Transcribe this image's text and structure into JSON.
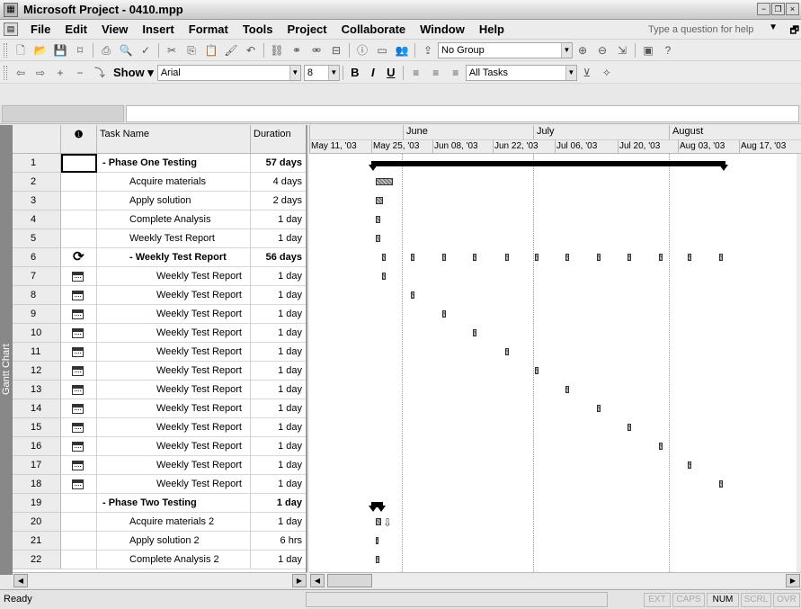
{
  "window": {
    "title": "Microsoft Project - 0410.mpp",
    "controls": [
      "−",
      "❐",
      "×"
    ]
  },
  "menu": {
    "items": [
      "File",
      "Edit",
      "View",
      "Insert",
      "Format",
      "Tools",
      "Project",
      "Collaborate",
      "Window",
      "Help"
    ],
    "help_placeholder": "Type a question for help"
  },
  "toolbar_standard": {
    "group_combo": "No Group"
  },
  "toolbar_formatting": {
    "show_label": "Show",
    "font": "Arial",
    "font_size": "8",
    "bold": "B",
    "italic": "I",
    "underline": "U",
    "filter_combo": "All Tasks"
  },
  "view_bar": {
    "label": "Gantt Chart"
  },
  "table": {
    "headers": {
      "indicator": "❶",
      "name": "Task Name",
      "duration": "Duration"
    },
    "rows": [
      {
        "id": "1",
        "name": "- Phase One Testing",
        "duration": "57 days",
        "level": 0,
        "summary": true,
        "indicator": ""
      },
      {
        "id": "2",
        "name": "Acquire materials",
        "duration": "4 days",
        "level": 1,
        "summary": false,
        "indicator": ""
      },
      {
        "id": "3",
        "name": "Apply solution",
        "duration": "2 days",
        "level": 1,
        "summary": false,
        "indicator": ""
      },
      {
        "id": "4",
        "name": "Complete Analysis",
        "duration": "1 day",
        "level": 1,
        "summary": false,
        "indicator": ""
      },
      {
        "id": "5",
        "name": "Weekly Test Report",
        "duration": "1 day",
        "level": 1,
        "summary": false,
        "indicator": ""
      },
      {
        "id": "6",
        "name": "- Weekly Test Report",
        "duration": "56 days",
        "level": 1,
        "summary": true,
        "indicator": "recurring"
      },
      {
        "id": "7",
        "name": "Weekly Test Report",
        "duration": "1 day",
        "level": 2,
        "summary": false,
        "indicator": "calendar"
      },
      {
        "id": "8",
        "name": "Weekly Test Report",
        "duration": "1 day",
        "level": 2,
        "summary": false,
        "indicator": "calendar"
      },
      {
        "id": "9",
        "name": "Weekly Test Report",
        "duration": "1 day",
        "level": 2,
        "summary": false,
        "indicator": "calendar"
      },
      {
        "id": "10",
        "name": "Weekly Test Report",
        "duration": "1 day",
        "level": 2,
        "summary": false,
        "indicator": "calendar"
      },
      {
        "id": "11",
        "name": "Weekly Test Report",
        "duration": "1 day",
        "level": 2,
        "summary": false,
        "indicator": "calendar"
      },
      {
        "id": "12",
        "name": "Weekly Test Report",
        "duration": "1 day",
        "level": 2,
        "summary": false,
        "indicator": "calendar"
      },
      {
        "id": "13",
        "name": "Weekly Test Report",
        "duration": "1 day",
        "level": 2,
        "summary": false,
        "indicator": "calendar"
      },
      {
        "id": "14",
        "name": "Weekly Test Report",
        "duration": "1 day",
        "level": 2,
        "summary": false,
        "indicator": "calendar"
      },
      {
        "id": "15",
        "name": "Weekly Test Report",
        "duration": "1 day",
        "level": 2,
        "summary": false,
        "indicator": "calendar"
      },
      {
        "id": "16",
        "name": "Weekly Test Report",
        "duration": "1 day",
        "level": 2,
        "summary": false,
        "indicator": "calendar"
      },
      {
        "id": "17",
        "name": "Weekly Test Report",
        "duration": "1 day",
        "level": 2,
        "summary": false,
        "indicator": "calendar"
      },
      {
        "id": "18",
        "name": "Weekly Test Report",
        "duration": "1 day",
        "level": 2,
        "summary": false,
        "indicator": "calendar"
      },
      {
        "id": "19",
        "name": "- Phase Two Testing",
        "duration": "1 day",
        "level": 0,
        "summary": true,
        "indicator": ""
      },
      {
        "id": "20",
        "name": "Acquire materials 2",
        "duration": "1 day",
        "level": 1,
        "summary": false,
        "indicator": ""
      },
      {
        "id": "21",
        "name": "Apply solution 2",
        "duration": "6 hrs",
        "level": 1,
        "summary": false,
        "indicator": ""
      },
      {
        "id": "22",
        "name": "Complete Analysis 2",
        "duration": "1 day",
        "level": 1,
        "summary": false,
        "indicator": ""
      }
    ]
  },
  "gantt": {
    "months": [
      "June",
      "July",
      "August"
    ],
    "weeks": [
      "May 11, '03",
      "May 25, '03",
      "Jun 08, '03",
      "Jun 22, '03",
      "Jul 06, '03",
      "Jul 20, '03",
      "Aug 03, '03",
      "Aug 17, '03"
    ]
  },
  "status": {
    "text": "Ready",
    "indicators": [
      {
        "label": "EXT",
        "on": false
      },
      {
        "label": "CAPS",
        "on": false
      },
      {
        "label": "NUM",
        "on": true
      },
      {
        "label": "SCRL",
        "on": false
      },
      {
        "label": "OVR",
        "on": false
      }
    ]
  }
}
